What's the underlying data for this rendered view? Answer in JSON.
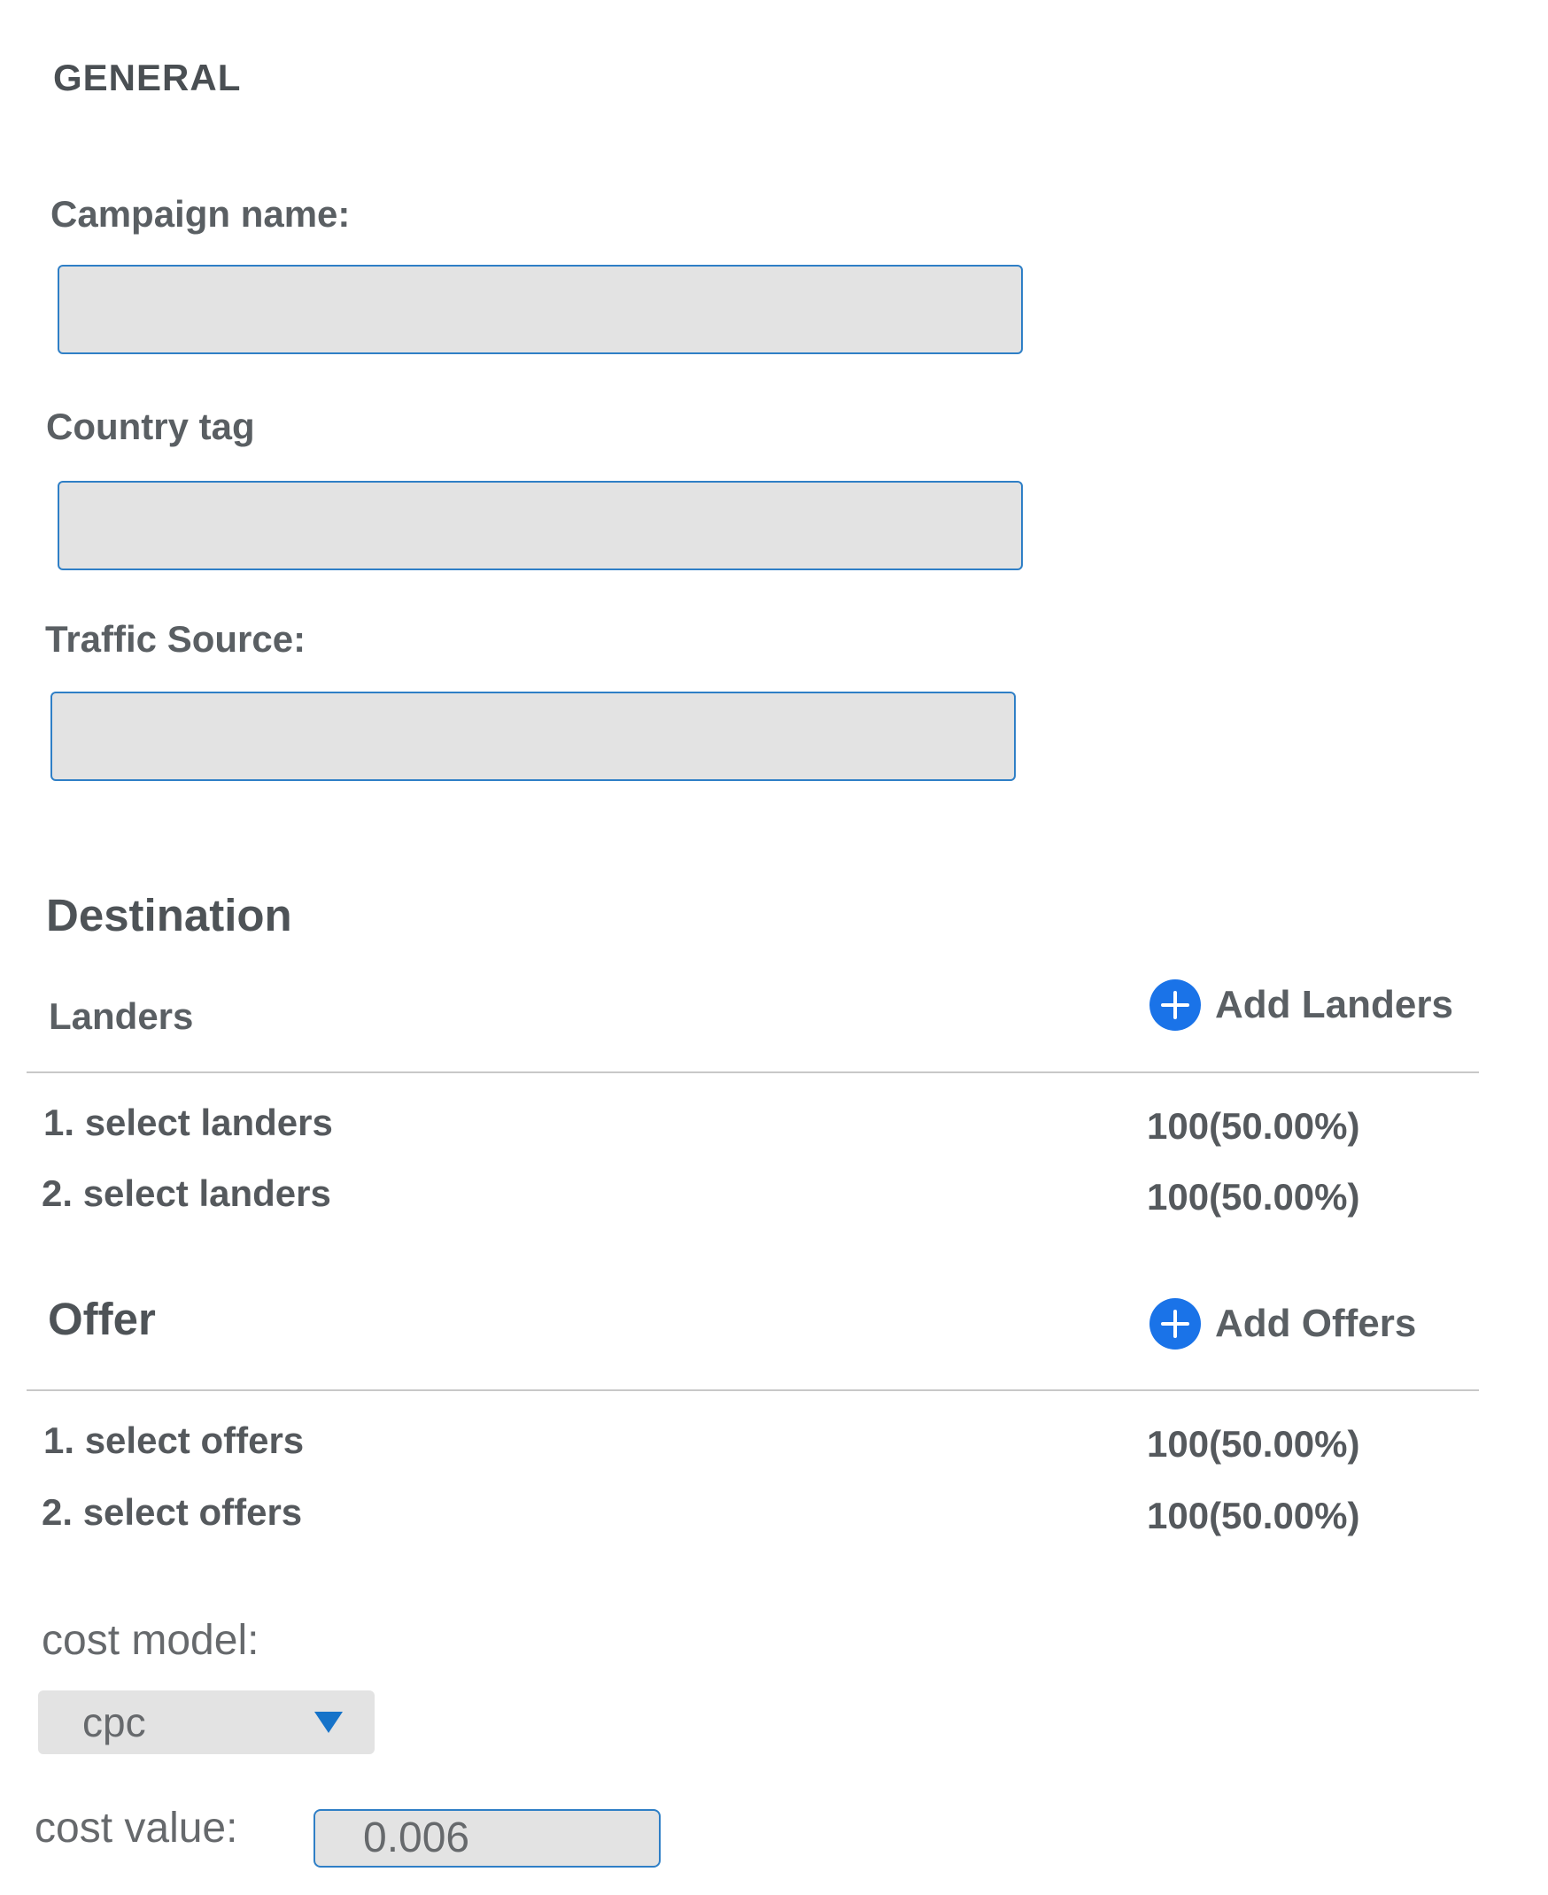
{
  "general": {
    "title": "GENERAL",
    "campaign_name_label": "Campaign name:",
    "campaign_name_value": "",
    "country_tag_label": "Country tag",
    "country_tag_value": "",
    "traffic_source_label": "Traffic Source:",
    "traffic_source_value": ""
  },
  "destination": {
    "title": "Destination",
    "landers": {
      "label": "Landers",
      "add_label": "Add Landers",
      "rows": [
        {
          "label": "1. select landers",
          "value": "100(50.00%)"
        },
        {
          "label": "2. select landers",
          "value": "100(50.00%)"
        }
      ]
    },
    "offers": {
      "label": "Offer",
      "add_label": "Add Offers",
      "rows": [
        {
          "label": "1. select offers",
          "value": "100(50.00%)"
        },
        {
          "label": "2. select offers",
          "value": "100(50.00%)"
        }
      ]
    }
  },
  "cost": {
    "model_label": "cost model:",
    "model_value": "cpc",
    "value_label": "cost value:",
    "value": "0.006"
  },
  "colors": {
    "accent": "#1a73e8",
    "input_border": "#2f7fc6",
    "input_bg": "#e3e3e3",
    "text": "#555a5e"
  },
  "icons": {
    "add": "plus-circle-icon",
    "dropdown": "triangle-down-icon"
  }
}
